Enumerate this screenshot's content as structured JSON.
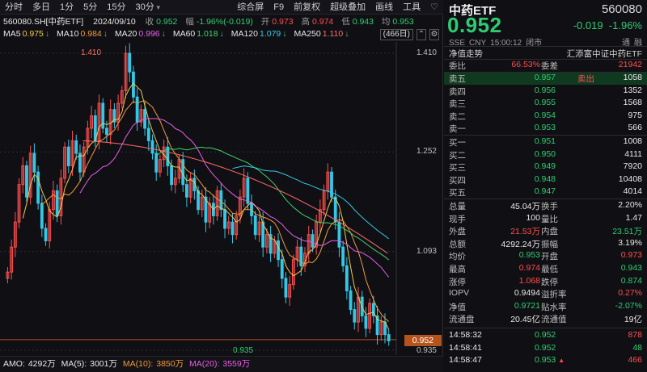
{
  "toolbar": {
    "items": [
      "分时",
      "多日",
      "1分",
      "5分",
      "15分",
      "30分"
    ],
    "right_items": [
      "综合屏",
      "F9",
      "前复权",
      "超级叠加",
      "画线",
      "工具"
    ],
    "heart_icon": "heart-icon"
  },
  "info": {
    "symbol": "560080.SH[中药ETF]",
    "date": "2024/09/10",
    "now_label": "收",
    "now_value": "0.952",
    "range_label": "幅",
    "range_value": "-1.96%(-0.019)",
    "open_label": "开",
    "open_value": "0.973",
    "high_label": "高",
    "high_value": "0.974",
    "low_label": "低",
    "low_value": "0.943",
    "avg_label": "均",
    "avg_value": "0.953"
  },
  "ma": [
    {
      "label": "MA5",
      "value": "0.975",
      "dir": "↓",
      "color": "#f2c84b"
    },
    {
      "label": "MA10",
      "value": "0.984",
      "dir": "↓",
      "color": "#f09a3a"
    },
    {
      "label": "MA20",
      "value": "0.996",
      "dir": "↓",
      "color": "#e85de8"
    },
    {
      "label": "MA60",
      "value": "1.018",
      "dir": "↓",
      "color": "#44d06a"
    },
    {
      "label": "MA120",
      "value": "1.079",
      "dir": "↓",
      "color": "#35c7e6"
    },
    {
      "label": "MA250",
      "value": "1.110",
      "dir": "↓",
      "color": "#ff6a6a"
    }
  ],
  "days_badge": "(466日)",
  "chart_data": {
    "type": "candlestick",
    "y_ticks": [
      "1.410",
      "1.252",
      "1.093",
      "0.935"
    ],
    "max_label": "1.410",
    "min_label": "0.935",
    "last_price_tag": "0.952",
    "ylim": [
      0.935,
      1.41
    ],
    "close_series": [
      1.06,
      1.1,
      1.14,
      1.2,
      1.23,
      1.18,
      1.25,
      1.22,
      1.17,
      1.13,
      1.11,
      1.16,
      1.19,
      1.15,
      1.21,
      1.26,
      1.23,
      1.27,
      1.25,
      1.22,
      1.26,
      1.29,
      1.31,
      1.27,
      1.33,
      1.29,
      1.28,
      1.32,
      1.3,
      1.33,
      1.35,
      1.41,
      1.38,
      1.34,
      1.3,
      1.32,
      1.29,
      1.27,
      1.25,
      1.22,
      1.24,
      1.26,
      1.23,
      1.2,
      1.21,
      1.24,
      1.2,
      1.18,
      1.21,
      1.19,
      1.16,
      1.18,
      1.14,
      1.17,
      1.15,
      1.19,
      1.16,
      1.13,
      1.14,
      1.12,
      1.15,
      1.18,
      1.21,
      1.17,
      1.15,
      1.12,
      1.14,
      1.1,
      1.12,
      1.09,
      1.11,
      1.08,
      1.05,
      1.02,
      1.04,
      1.08,
      1.1,
      1.07,
      1.09,
      1.12,
      1.1,
      1.14,
      1.16,
      1.19,
      1.22,
      1.18,
      1.14,
      1.1,
      1.07,
      1.03,
      1.0,
      0.98,
      1.02,
      0.99,
      0.97,
      1.01,
      0.99,
      0.96,
      0.98,
      0.96,
      0.95
    ]
  },
  "bottom": {
    "amo_label": "AMO:",
    "amo_value": "4292万",
    "ma5_label": "MA(5):",
    "ma5_value": "3001万",
    "ma10_label": "MA(10):",
    "ma10_value": "3850万",
    "ma20_label": "MA(20):",
    "ma20_value": "3559万"
  },
  "quote": {
    "name": "中药ETF",
    "code": "560080",
    "price": "0.952",
    "change": "-0.019",
    "change_pct": "-1.96%",
    "exchange": "SSE",
    "currency": "CNY",
    "time": "15:00:12",
    "status": "闭市",
    "flag1": "通",
    "flag2": "融",
    "tab_label": "净值走势",
    "fund_name": "汇添富中证中药ETF"
  },
  "weibi": {
    "label": "委比",
    "value": "66.53%",
    "label2": "委差",
    "value2": "21942"
  },
  "asks": [
    {
      "label": "卖五",
      "price": "0.957",
      "vol": "1058",
      "tag": "卖出"
    },
    {
      "label": "卖四",
      "price": "0.956",
      "vol": "1352"
    },
    {
      "label": "卖三",
      "price": "0.955",
      "vol": "1568"
    },
    {
      "label": "卖二",
      "price": "0.954",
      "vol": "975"
    },
    {
      "label": "卖一",
      "price": "0.953",
      "vol": "566"
    }
  ],
  "bids": [
    {
      "label": "买一",
      "price": "0.951",
      "vol": "1008"
    },
    {
      "label": "买二",
      "price": "0.950",
      "vol": "4111"
    },
    {
      "label": "买三",
      "price": "0.949",
      "vol": "7920"
    },
    {
      "label": "买四",
      "price": "0.948",
      "vol": "10408"
    },
    {
      "label": "买五",
      "price": "0.947",
      "vol": "4014"
    }
  ],
  "stats": [
    {
      "l1": "总量",
      "v1": "45.04万",
      "l2": "换手",
      "v2": "2.20%",
      "c1": "white",
      "c2": "white"
    },
    {
      "l1": "现手",
      "v1": "100",
      "l2": "量比",
      "v2": "1.47",
      "c1": "white",
      "c2": "white"
    },
    {
      "l1": "外盘",
      "v1": "21.53万",
      "l2": "内盘",
      "v2": "23.51万",
      "c1": "red",
      "c2": "green"
    },
    {
      "l1": "总额",
      "v1": "4292.24万",
      "l2": "振幅",
      "v2": "3.19%",
      "c1": "white",
      "c2": "white"
    },
    {
      "l1": "均价",
      "v1": "0.953",
      "l2": "开盘",
      "v2": "0.973",
      "c1": "green",
      "c2": "red"
    },
    {
      "l1": "最高",
      "v1": "0.974",
      "l2": "最低",
      "v2": "0.943",
      "c1": "red",
      "c2": "green"
    },
    {
      "l1": "涨停",
      "v1": "1.068",
      "l2": "跌停",
      "v2": "0.874",
      "c1": "red",
      "c2": "green"
    },
    {
      "l1": "IOPV",
      "v1": "0.9494",
      "l2": "溢折率",
      "v2": "0.27%",
      "c1": "white",
      "c2": "red"
    },
    {
      "l1": "净值",
      "v1": "0.9721",
      "l2": "贴水率",
      "v2": "-2.07%",
      "c1": "green",
      "c2": "green"
    },
    {
      "l1": "流通盘",
      "v1": "20.45亿",
      "l2": "流通值",
      "v2": "19亿",
      "c1": "white",
      "c2": "white"
    }
  ],
  "ticks": [
    {
      "time": "14:58:32",
      "price": "0.952",
      "vol": "878",
      "pcolor": "green",
      "vcolor": "red",
      "arrow": ""
    },
    {
      "time": "14:58:41",
      "price": "0.952",
      "vol": "48",
      "pcolor": "green",
      "vcolor": "green",
      "arrow": ""
    },
    {
      "time": "14:58:47",
      "price": "0.953",
      "vol": "466",
      "pcolor": "green",
      "vcolor": "red",
      "arrow": "▲"
    }
  ]
}
